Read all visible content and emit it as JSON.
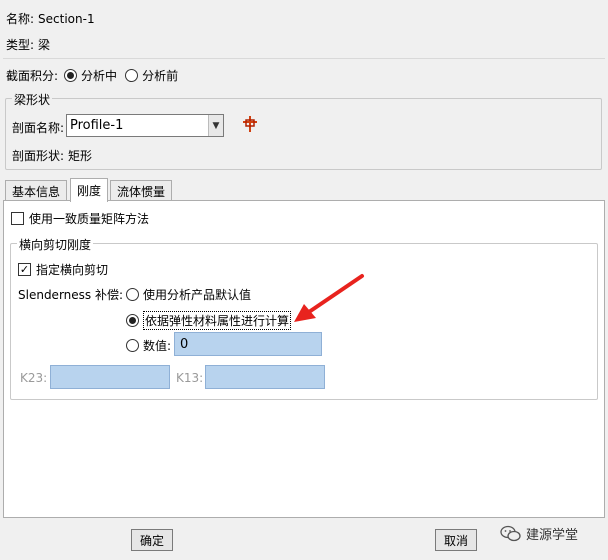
{
  "info": {
    "name_label": "名称:",
    "name_value": "Section-1",
    "type_label": "类型:",
    "type_value": "梁"
  },
  "integration": {
    "label": "截面积分:",
    "options": [
      "分析中",
      "分析前"
    ],
    "selected": "分析中"
  },
  "beam_shape": {
    "group_title": "梁形状",
    "profile_label": "剖面名称:",
    "profile_value": "Profile-1",
    "shape_label": "剖面形状:",
    "shape_value": "矩形"
  },
  "tabs": [
    {
      "label": "基本信息",
      "active": false
    },
    {
      "label": "刚度",
      "active": true
    },
    {
      "label": "流体惯量",
      "active": false
    }
  ],
  "stiffness": {
    "consistent_mass_label": "使用一致质量矩阵方法",
    "consistent_mass_checked": false,
    "shear_group_title": "横向剪切刚度",
    "specify_shear_label": "指定横向剪切",
    "specify_shear_checked": true,
    "slenderness_label": "Slenderness 补偿:",
    "options": {
      "default": "使用分析产品默认值",
      "material": "依据弹性材料属性进行计算",
      "value": "数值:"
    },
    "selected": "material",
    "value_field": "0",
    "k23_label": "K23:",
    "k23_value": "",
    "k13_label": "K13:",
    "k13_value": ""
  },
  "buttons": {
    "ok": "确定",
    "cancel": "取消"
  },
  "watermark": "建源学堂",
  "colors": {
    "field_fill": "#b8d3ee",
    "arrow": "#e8231e"
  }
}
